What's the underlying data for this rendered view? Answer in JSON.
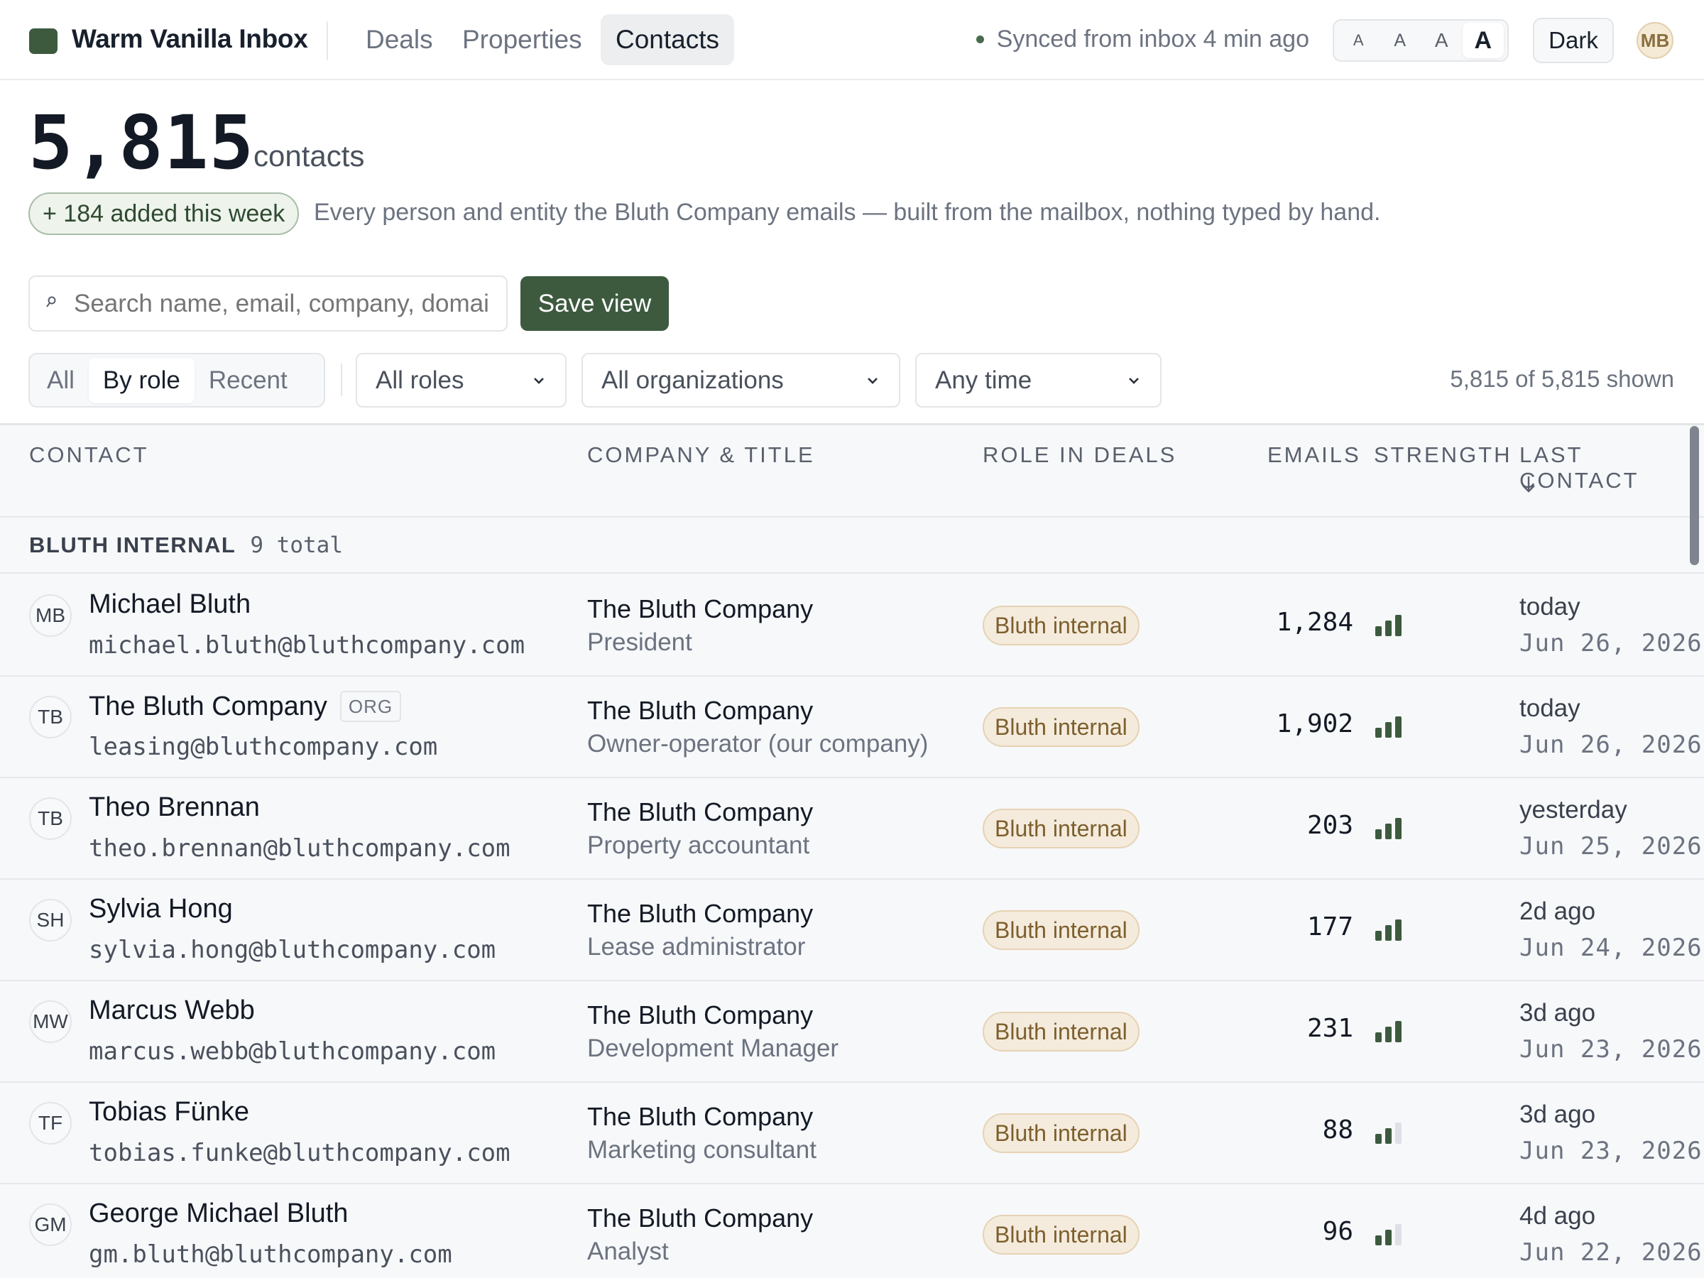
{
  "app": {
    "brand": "Warm Vanilla Inbox",
    "nav": [
      {
        "label": "Deals",
        "active": false
      },
      {
        "label": "Properties",
        "active": false
      },
      {
        "label": "Contacts",
        "active": true
      }
    ],
    "sync_status": "Synced from inbox 4 min ago",
    "font_sizes": [
      "A",
      "A",
      "A",
      "A"
    ],
    "font_size_active_index": 3,
    "theme_toggle": "Dark",
    "user_initials": "MB"
  },
  "header": {
    "count": "5,815",
    "count_unit": "contacts",
    "added_badge": "+ 184 added this week",
    "subtitle": "Every person and entity the Bluth Company emails — built from the mailbox, nothing typed by hand."
  },
  "search": {
    "placeholder": "Search name, email, company, domai",
    "save_label": "Save view"
  },
  "filters": {
    "segments": [
      {
        "label": "All",
        "active": false
      },
      {
        "label": "By role",
        "active": true
      },
      {
        "label": "Recent",
        "active": false
      }
    ],
    "role": "All roles",
    "organization": "All organizations",
    "time": "Any time",
    "shown": "5,815 of 5,815 shown"
  },
  "table": {
    "columns": {
      "contact": "CONTACT",
      "company": "COMPANY & TITLE",
      "role": "ROLE IN DEALS",
      "emails": "EMAILS",
      "strength": "STRENGTH",
      "last_contact": "LAST CONTACT"
    },
    "group": {
      "name": "BLUTH INTERNAL",
      "count": "9 total"
    },
    "rows": [
      {
        "initials": "MB",
        "name": "Michael Bluth",
        "org_tag": "",
        "email": "michael.bluth@bluthcompany.com",
        "company": "The Bluth Company",
        "title": "President",
        "role": "Bluth internal",
        "emails": "1,284",
        "strength": 3,
        "last": "today",
        "date": "Jun 26, 2026"
      },
      {
        "initials": "TB",
        "name": "The Bluth Company",
        "org_tag": "ORG",
        "email": "leasing@bluthcompany.com",
        "company": "The Bluth Company",
        "title": "Owner-operator (our company)",
        "role": "Bluth internal",
        "emails": "1,902",
        "strength": 3,
        "last": "today",
        "date": "Jun 26, 2026"
      },
      {
        "initials": "TB",
        "name": "Theo Brennan",
        "org_tag": "",
        "email": "theo.brennan@bluthcompany.com",
        "company": "The Bluth Company",
        "title": "Property accountant",
        "role": "Bluth internal",
        "emails": "203",
        "strength": 3,
        "last": "yesterday",
        "date": "Jun 25, 2026"
      },
      {
        "initials": "SH",
        "name": "Sylvia Hong",
        "org_tag": "",
        "email": "sylvia.hong@bluthcompany.com",
        "company": "The Bluth Company",
        "title": "Lease administrator",
        "role": "Bluth internal",
        "emails": "177",
        "strength": 3,
        "last": "2d ago",
        "date": "Jun 24, 2026"
      },
      {
        "initials": "MW",
        "name": "Marcus Webb",
        "org_tag": "",
        "email": "marcus.webb@bluthcompany.com",
        "company": "The Bluth Company",
        "title": "Development Manager",
        "role": "Bluth internal",
        "emails": "231",
        "strength": 3,
        "last": "3d ago",
        "date": "Jun 23, 2026"
      },
      {
        "initials": "TF",
        "name": "Tobias Fünke",
        "org_tag": "",
        "email": "tobias.funke@bluthcompany.com",
        "company": "The Bluth Company",
        "title": "Marketing consultant",
        "role": "Bluth internal",
        "emails": "88",
        "strength": 2,
        "last": "3d ago",
        "date": "Jun 23, 2026"
      },
      {
        "initials": "GM",
        "name": "George Michael Bluth",
        "org_tag": "",
        "email": "gm.bluth@bluthcompany.com",
        "company": "The Bluth Company",
        "title": "Analyst",
        "role": "Bluth internal",
        "emails": "96",
        "strength": 2,
        "last": "4d ago",
        "date": "Jun 22, 2026"
      }
    ]
  },
  "colors": {
    "accent": "#3d5a3f",
    "role_pill_bg": "#f4ebdd",
    "role_pill_text": "#7d5f2c",
    "strength_on": "#3d5a3f",
    "strength_off": "#dde0e4"
  },
  "icons": {
    "search": "search-icon",
    "sort": "arrow-down-icon",
    "select": "chevron-down-icon"
  }
}
